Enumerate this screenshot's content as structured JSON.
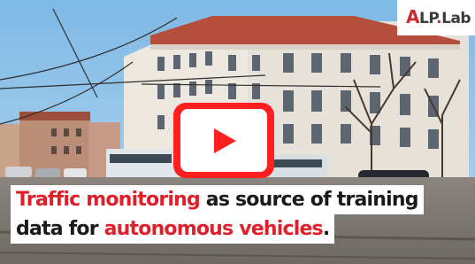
{
  "logo": {
    "mark": "A",
    "brand": "LP",
    "dot": ".",
    "suffix": "Lab"
  },
  "caption": {
    "line1_highlight": "Traffic monitoring",
    "line1_rest": " as source of training",
    "line2_lead": "data for ",
    "line2_highlight": "autonomous vehicles",
    "line2_end": "."
  },
  "colors": {
    "accent": "#e01f2a",
    "play_button": "#ff1f1f",
    "sky": "#8ec5ea",
    "building": "#e9e4dc"
  },
  "icons": {
    "play": "play-icon"
  }
}
